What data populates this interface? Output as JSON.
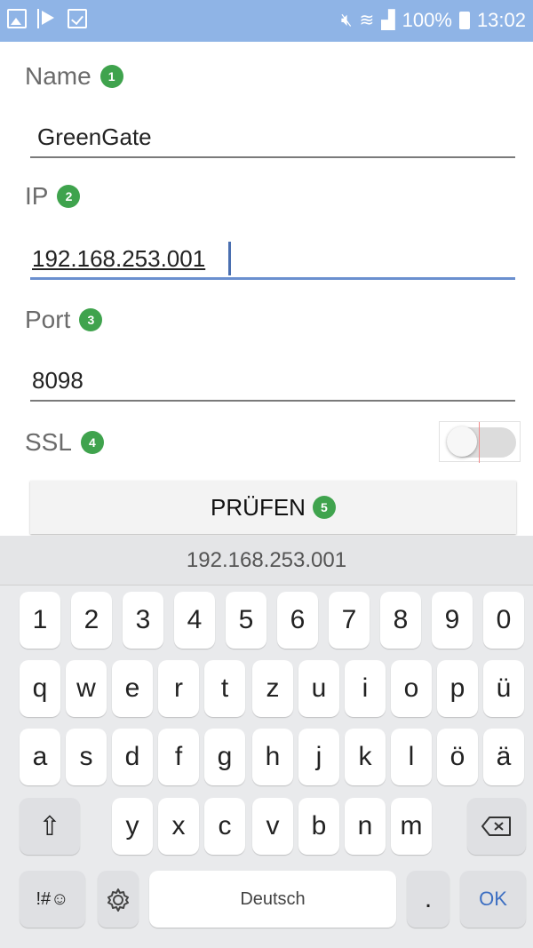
{
  "status_bar": {
    "left_icons": [
      "image-icon",
      "play-store-icon",
      "checklist-icon"
    ],
    "right_icons": [
      "mute-icon",
      "wifi-icon",
      "signal-icon",
      "battery-icon"
    ],
    "battery": "100%",
    "time": "13:02"
  },
  "form": {
    "name": {
      "label": "Name",
      "badge": "1",
      "value": "GreenGate"
    },
    "ip": {
      "label": "IP",
      "badge": "2",
      "value": "192.168.253.001"
    },
    "port": {
      "label": "Port",
      "badge": "3",
      "value": "8098"
    },
    "ssl": {
      "label": "SSL",
      "badge": "4",
      "enabled": false
    },
    "check_button": {
      "label": "PRÜFEN",
      "badge": "5"
    }
  },
  "keyboard": {
    "suggestion": "192.168.253.001",
    "row_numbers": [
      "1",
      "2",
      "3",
      "4",
      "5",
      "6",
      "7",
      "8",
      "9",
      "0"
    ],
    "row_1": [
      "q",
      "w",
      "e",
      "r",
      "t",
      "z",
      "u",
      "i",
      "o",
      "p",
      "ü"
    ],
    "row_2": [
      "a",
      "s",
      "d",
      "f",
      "g",
      "h",
      "j",
      "k",
      "l",
      "ö",
      "ä"
    ],
    "row_3": [
      "y",
      "x",
      "c",
      "v",
      "b",
      "n",
      "m"
    ],
    "shift_label": "⇧",
    "backspace_icon": "backspace-icon",
    "symbols_label": "!#☺",
    "settings_icon": "gear-icon",
    "space_label": "Deutsch",
    "period_label": ".",
    "ok_label": "OK"
  },
  "colors": {
    "status_bar": "#8fb4e6",
    "badge": "#3fa34d",
    "focus_line": "#6a8fcf",
    "ok_text": "#3d6fc2"
  }
}
